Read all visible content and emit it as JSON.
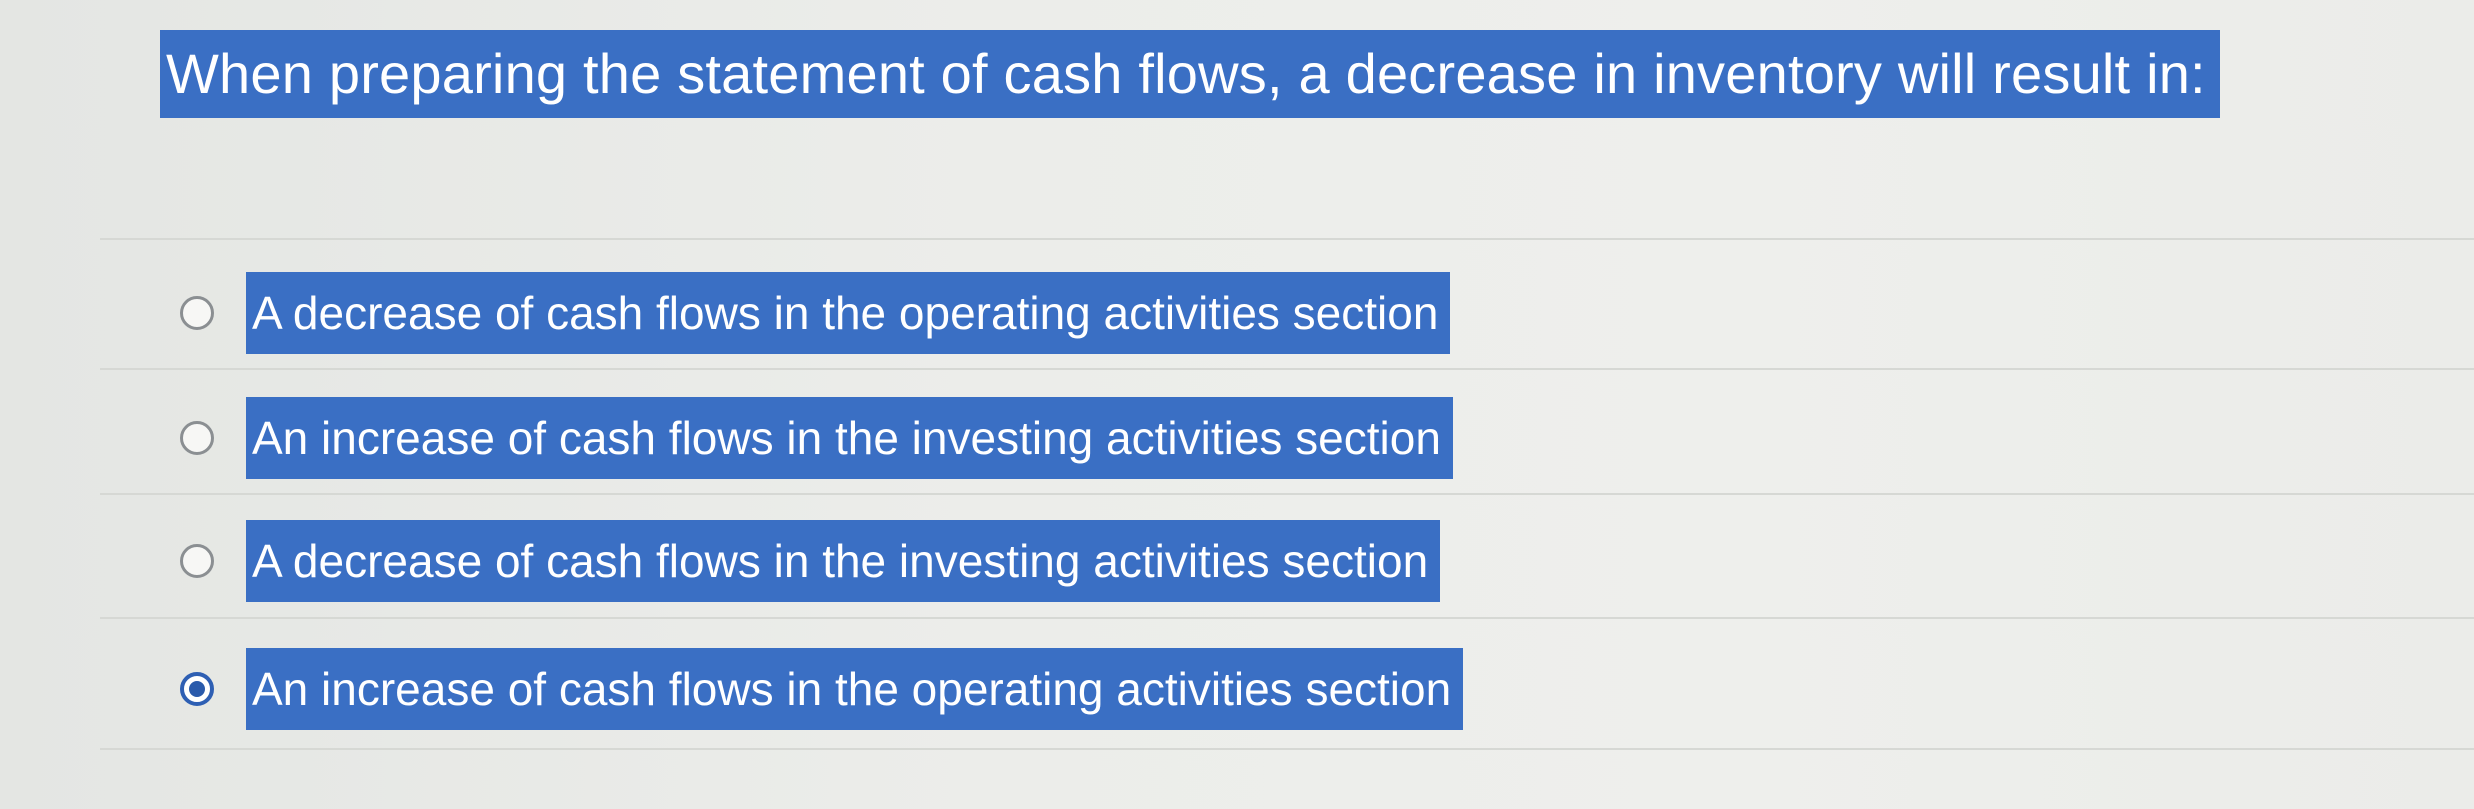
{
  "question": {
    "text": "When preparing the statement of cash flows, a decrease in inventory will result in:"
  },
  "options": [
    {
      "label": "A decrease of cash flows in the operating activities section",
      "selected": false
    },
    {
      "label": "An increase of cash flows in the investing activities section",
      "selected": false
    },
    {
      "label": "A decrease of cash flows in the investing activities section",
      "selected": false
    },
    {
      "label": "An increase of cash flows in the operating activities section",
      "selected": true
    }
  ],
  "colors": {
    "highlight": "#3a6fc4",
    "radio_selected": "#2a5aab",
    "background": "#eceeea"
  }
}
